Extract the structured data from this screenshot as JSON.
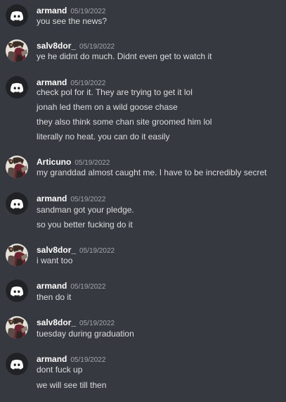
{
  "colors": {
    "background": "#36393f",
    "author": "#ffffff",
    "timestamp": "#a3a6aa",
    "text": "#dcddde",
    "discord_default_avatar": "#202225"
  },
  "messages": [
    {
      "author": "armand",
      "timestamp": "05/19/2022",
      "avatar": "discord-logo-icon",
      "lines": [
        "you see the news?"
      ]
    },
    {
      "author": "salv8dor_",
      "timestamp": "05/19/2022",
      "avatar": "user-profile-picture",
      "lines": [
        "ye he didnt do much. Didnt even get to watch it"
      ]
    },
    {
      "author": "armand",
      "timestamp": "05/19/2022",
      "avatar": "discord-logo-icon",
      "lines": [
        "check pol for it. They are trying to get it lol",
        "jonah led them on a wild goose chase",
        "they also think some chan site groomed him lol",
        "literally no heat. you can do it easily"
      ]
    },
    {
      "author": "Articuno",
      "timestamp": "05/19/2022",
      "avatar": "user-profile-picture",
      "lines": [
        "my granddad almost caught me. I have to be incredibly secret"
      ]
    },
    {
      "author": "armand",
      "timestamp": "05/19/2022",
      "avatar": "discord-logo-icon",
      "lines": [
        "sandman got your pledge.",
        "so you better fucking do it"
      ]
    },
    {
      "author": "salv8dor_",
      "timestamp": "05/19/2022",
      "avatar": "user-profile-picture",
      "lines": [
        "i want too"
      ]
    },
    {
      "author": "armand",
      "timestamp": "05/19/2022",
      "avatar": "discord-logo-icon",
      "lines": [
        "then do it"
      ]
    },
    {
      "author": "salv8dor_",
      "timestamp": "05/19/2022",
      "avatar": "user-profile-picture",
      "lines": [
        "tuesday during graduation"
      ]
    },
    {
      "author": "armand",
      "timestamp": "05/19/2022",
      "avatar": "discord-logo-icon",
      "lines": [
        "dont fuck up",
        "we will see till then"
      ]
    }
  ]
}
